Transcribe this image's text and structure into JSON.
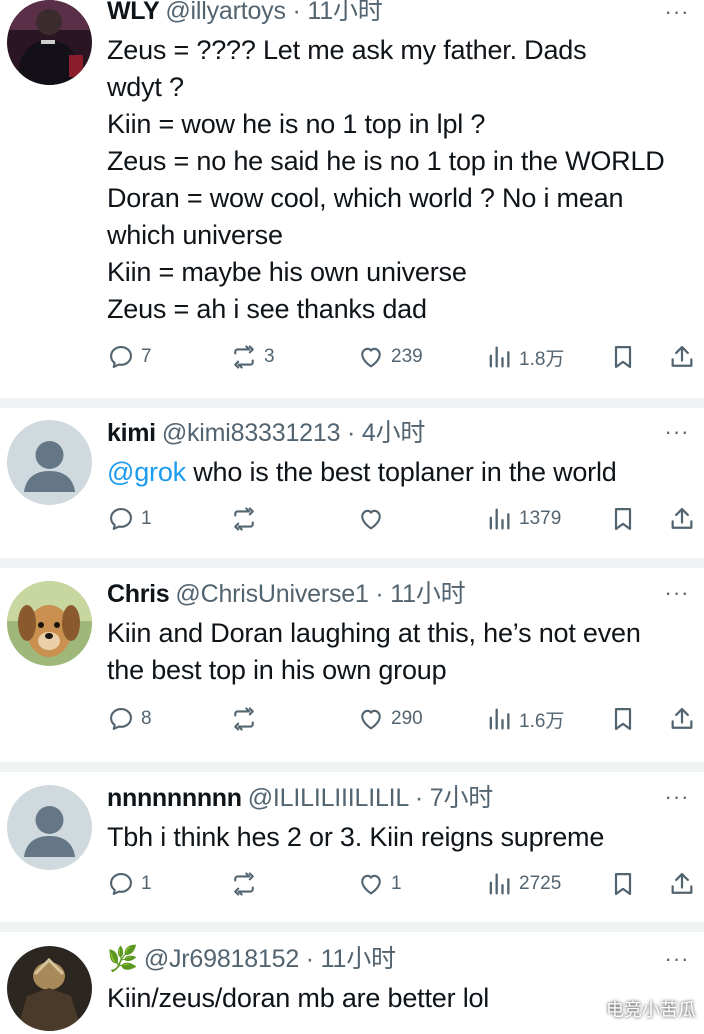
{
  "colors": {
    "text": "#0f1419",
    "muted": "#536471",
    "link": "#1d9bf0",
    "separator": "#eff3f4"
  },
  "more_label": "···",
  "tweets": [
    {
      "name": "WLY",
      "handle": "@illyartoys · 11小时",
      "lines": [
        "Zeus = ???? Let me ask my father. Dads",
        "wdyt ?",
        "Kiin = wow he is no 1 top in lpl ?",
        "Zeus = no he said he is no 1 top in the WORLD",
        "Doran = wow cool, which world ? No i mean",
        "which universe",
        "Kiin = maybe his own universe",
        "Zeus = ah i see thanks dad"
      ],
      "replies": "7",
      "reposts": "3",
      "likes": "239",
      "views": "1.8万"
    },
    {
      "name": "kimi",
      "handle": "@kimi83331213 · 4小时",
      "mention": "@grok",
      "text": " who is the best toplaner in the world",
      "replies": "1",
      "reposts": "",
      "likes": "",
      "views": "1379"
    },
    {
      "name": "Chris",
      "handle": "@ChrisUniverse1 · 11小时",
      "lines": [
        "Kiin and Doran laughing at this, he’s not even",
        "the best top in his own group"
      ],
      "replies": "8",
      "reposts": "",
      "likes": "290",
      "views": "1.6万"
    },
    {
      "name": "nnnnnnnnn",
      "handle": "@ILILILIIILILIL · 7小时",
      "lines": [
        "Tbh i think hes 2 or 3. Kiin reigns supreme"
      ],
      "replies": "1",
      "reposts": "",
      "likes": "1",
      "views": "2725"
    },
    {
      "name": "🌿",
      "handle": "@Jr69818152 · 11小时",
      "lines": [
        "Kiin/zeus/doran mb are better lol"
      ]
    }
  ],
  "icons": [
    "reply-icon",
    "repost-icon",
    "like-icon",
    "views-icon",
    "bookmark-icon",
    "share-icon",
    "more-icon"
  ],
  "watermark": "电竞小苦瓜"
}
